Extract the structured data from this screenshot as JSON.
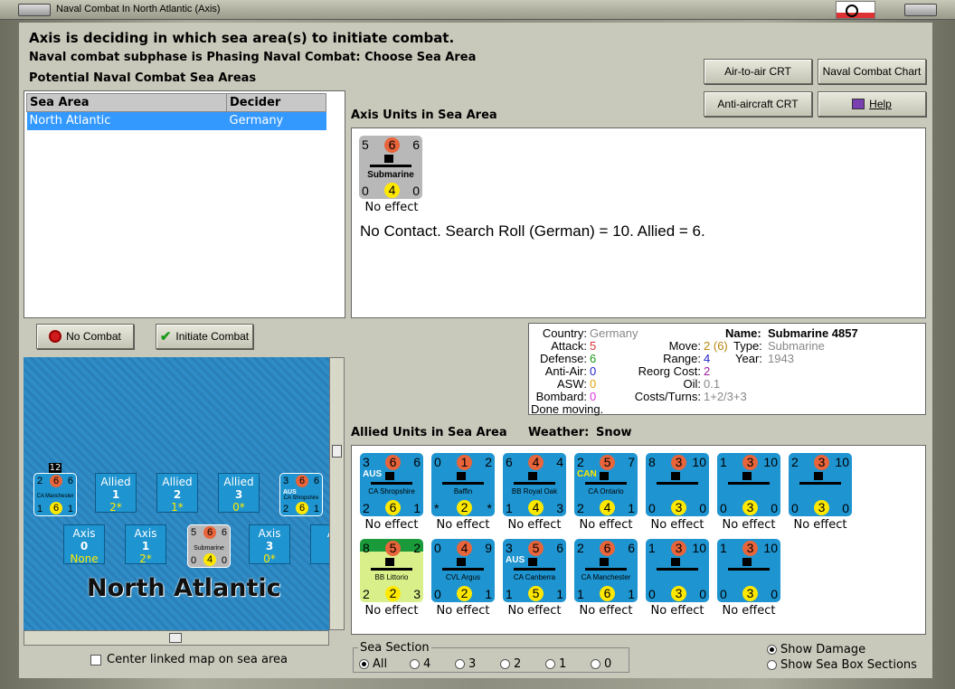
{
  "window": {
    "title": "Naval Combat In North Atlantic (Axis)"
  },
  "header": {
    "line1": "Axis is deciding in which sea area(s) to initiate combat.",
    "line2": "Naval combat subphase is Phasing Naval Combat: Choose Sea Area",
    "line3": "Potential Naval Combat Sea Areas"
  },
  "buttons": {
    "air_to_air": "Air-to-air CRT",
    "naval_chart": "Naval Combat Chart",
    "anti_aircraft": "Anti-aircraft CRT",
    "help": "Help",
    "no_combat": "No Combat",
    "initiate": "Initiate Combat"
  },
  "sea_table": {
    "headers": [
      "Sea Area",
      "Decider"
    ],
    "rows": [
      {
        "sea": "North Atlantic",
        "decider": "Germany"
      }
    ]
  },
  "axis_units": {
    "title": "Axis Units in Sea Area",
    "unit": {
      "tl": "5",
      "tc": "6",
      "tr": "6",
      "name": "Submarine",
      "bl": "0",
      "bc": "4",
      "br": "0",
      "effect": "No effect"
    },
    "search_result": "No Contact.  Search Roll (German) = 10.  Allied = 6."
  },
  "unit_info": {
    "country_label": "Country:",
    "country": "Germany",
    "attack_label": "Attack:",
    "attack": "5",
    "defense_label": "Defense:",
    "defense": "6",
    "antiair_label": "Anti-Air:",
    "antiair": "0",
    "asw_label": "ASW:",
    "asw": "0",
    "bombard_label": "Bombard:",
    "bombard": "0",
    "status": "Done moving.",
    "name_label": "Name:",
    "name": "Submarine 4857",
    "move_label": "Move:",
    "move": "2",
    "move_extra": "(6)",
    "type_label": "Type:",
    "type": "Submarine",
    "year_label": "Year:",
    "year": "1943",
    "range_label": "Range:",
    "range": "4",
    "reorg_label": "Reorg Cost:",
    "reorg": "2",
    "oil_label": "Oil:",
    "oil": "0.1",
    "costs_label": "Costs/Turns:",
    "costs": "1+2/3+3"
  },
  "allied_units": {
    "title": "Allied Units in Sea Area",
    "weather_label": "Weather:",
    "weather": "Snow",
    "row1": [
      {
        "tl": "3",
        "tc": "6",
        "tr": "6",
        "nat": "AUS",
        "name": "CA Shropshire",
        "bl": "2",
        "bc": "6",
        "br": "1",
        "effect": "No effect"
      },
      {
        "tl": "0",
        "tc": "1",
        "tr": "2",
        "nat": "",
        "name": "Baffin",
        "bl": "*",
        "bc": "2",
        "br": "*",
        "effect": "No effect"
      },
      {
        "tl": "6",
        "tc": "4",
        "tr": "4",
        "nat": "",
        "name": "BB Royal Oak",
        "bl": "1",
        "bc": "4",
        "br": "3",
        "effect": "No effect"
      },
      {
        "tl": "2",
        "tc": "5",
        "tr": "7",
        "nat": "CAN",
        "name": "CA Ontario",
        "bl": "2",
        "bc": "4",
        "br": "1",
        "effect": "No effect"
      },
      {
        "tl": "8",
        "tc": "3",
        "tr": "10",
        "nat": "",
        "name": "",
        "bl": "0",
        "bc": "3",
        "br": "0",
        "effect": "No effect"
      },
      {
        "tl": "1",
        "tc": "3",
        "tr": "10",
        "nat": "",
        "name": "",
        "bl": "0",
        "bc": "3",
        "br": "0",
        "effect": "No effect"
      },
      {
        "tl": "2",
        "tc": "3",
        "tr": "10",
        "nat": "",
        "name": "",
        "bl": "0",
        "bc": "3",
        "br": "0",
        "effect": "No effect"
      }
    ],
    "row2": [
      {
        "tl": "8",
        "tc": "5",
        "tr": "2",
        "nat": "",
        "name": "BB Littorio",
        "bl": "2",
        "bc": "2",
        "br": "3",
        "effect": "No effect"
      },
      {
        "tl": "0",
        "tc": "4",
        "tr": "9",
        "nat": "",
        "name": "CVL Argus",
        "bl": "0",
        "bc": "2",
        "br": "1",
        "effect": "No effect"
      },
      {
        "tl": "3",
        "tc": "5",
        "tr": "6",
        "nat": "AUS",
        "name": "CA Canberra",
        "bl": "1",
        "bc": "5",
        "br": "1",
        "effect": "No effect"
      },
      {
        "tl": "2",
        "tc": "6",
        "tr": "6",
        "nat": "",
        "name": "CA Manchester",
        "bl": "1",
        "bc": "6",
        "br": "1",
        "effect": "No effect"
      },
      {
        "tl": "1",
        "tc": "3",
        "tr": "10",
        "nat": "",
        "name": "",
        "bl": "0",
        "bc": "3",
        "br": "0",
        "effect": "No effect"
      },
      {
        "tl": "1",
        "tc": "3",
        "tr": "10",
        "nat": "",
        "name": "",
        "bl": "0",
        "bc": "3",
        "br": "0",
        "effect": "No effect"
      }
    ]
  },
  "map": {
    "sea_name": "North Atlantic",
    "stack_count": "12",
    "allied_boxes": [
      {
        "label": "Allied",
        "num": "1",
        "val": "2*"
      },
      {
        "label": "Allied",
        "num": "2",
        "val": "1*"
      },
      {
        "label": "Allied",
        "num": "3",
        "val": "0*"
      }
    ],
    "axis_boxes": [
      {
        "label": "Axis",
        "num": "0",
        "val": "None"
      },
      {
        "label": "Axis",
        "num": "1",
        "val": "2*"
      },
      {
        "label": "Axis",
        "num": "3",
        "val": "0*"
      },
      {
        "label": "A",
        "num": "",
        "val": ""
      }
    ],
    "center_linked": "Center linked map on sea area",
    "left_unit": {
      "tl": "2",
      "tc": "6",
      "tr": "6",
      "name": "CA Manchester",
      "bl": "1",
      "bc": "6",
      "br": "1"
    },
    "right_unit": {
      "tl": "3",
      "tc": "6",
      "tr": "6",
      "nat": "AUS",
      "name": "CA Shropshire",
      "bl": "2",
      "bc": "6",
      "br": "1"
    },
    "axis_unit": {
      "tl": "5",
      "tc": "6",
      "tr": "6",
      "name": "Submarine",
      "bl": "0",
      "bc": "4",
      "br": "0"
    }
  },
  "sea_section": {
    "title": "Sea Section",
    "options": [
      "All",
      "4",
      "3",
      "2",
      "1",
      "0"
    ]
  },
  "display_options": {
    "show_damage": "Show Damage",
    "show_sea_box": "Show Sea Box Sections"
  }
}
